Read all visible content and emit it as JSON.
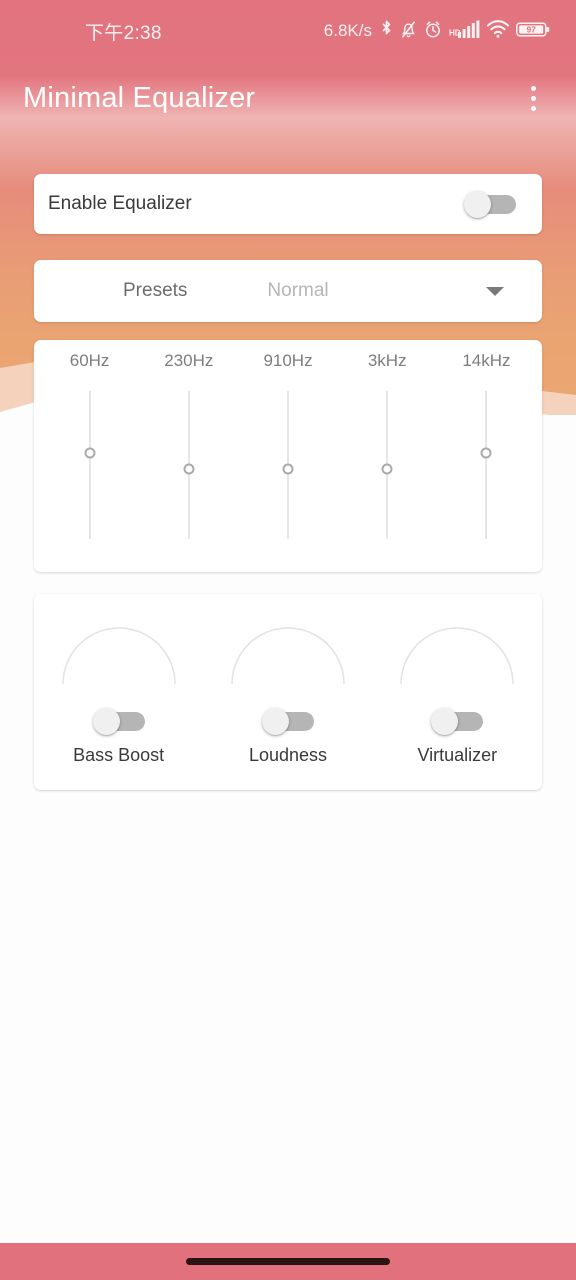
{
  "status_bar": {
    "time": "下午2:38",
    "network_speed": "6.8K/s",
    "icons": [
      "bluetooth-icon",
      "bell-muted-icon",
      "alarm-icon",
      "hd-icon",
      "signal-bars-icon",
      "wifi-icon",
      "battery-icon"
    ],
    "battery_level": "97"
  },
  "app_bar": {
    "title": "Minimal Equalizer",
    "overflow_menu": "overflow-menu-icon"
  },
  "enable_card": {
    "label": "Enable Equalizer",
    "toggle_state": "off"
  },
  "presets_card": {
    "label": "Presets",
    "value": "Normal",
    "caret": "chevron-down-icon"
  },
  "equalizer": {
    "bands": [
      {
        "label": "60Hz",
        "thumb_pct": 42
      },
      {
        "label": "230Hz",
        "thumb_pct": 53
      },
      {
        "label": "910Hz",
        "thumb_pct": 53
      },
      {
        "label": "3kHz",
        "thumb_pct": 53
      },
      {
        "label": "14kHz",
        "thumb_pct": 42
      }
    ]
  },
  "effects": [
    {
      "label": "Bass Boost",
      "toggle_state": "off",
      "knob_value": 0
    },
    {
      "label": "Loudness",
      "toggle_state": "off",
      "knob_value": 0
    },
    {
      "label": "Virtualizer",
      "toggle_state": "off",
      "knob_value": 0
    }
  ],
  "colors": {
    "gradient_top": "#e2737f",
    "gradient_bottom": "#eba871",
    "nav_bar": "#e0717d",
    "card_bg": "#ffffff",
    "toggle_track_off": "#b5b5b5",
    "toggle_thumb_off": "#f0f0f0",
    "slider_track": "#e6e6e6",
    "slider_thumb_border": "#aaaaaa"
  },
  "nav_bar": {
    "home_indicator": "home-indicator"
  }
}
